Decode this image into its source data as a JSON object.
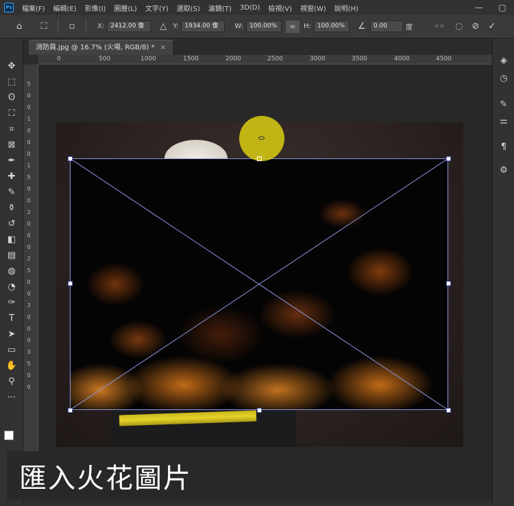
{
  "menubar": {
    "items": [
      "檔案(F)",
      "編輯(E)",
      "影像(I)",
      "圖層(L)",
      "文字(Y)",
      "選取(S)",
      "濾鏡(T)",
      "3D(D)",
      "檢視(V)",
      "視窗(W)",
      "說明(H)"
    ]
  },
  "options": {
    "x_label": "X:",
    "x_value": "2412.00 像",
    "y_label": "Y:",
    "y_value": "1934.00 像",
    "w_label": "W:",
    "w_value": "100.00%",
    "h_label": "H:",
    "h_value": "100.00%",
    "angle_value": "0.00",
    "angle_unit": "度"
  },
  "document": {
    "tab_title": "消防員.jpg @ 16.7% (火場, RGB/8) *"
  },
  "ruler": {
    "top_ticks": [
      "0",
      "500",
      "1000",
      "1500",
      "2000",
      "2500",
      "3000",
      "3500",
      "4000",
      "4500"
    ],
    "left_ticks": [
      "5",
      "0",
      "0",
      "1",
      "0",
      "0",
      "0",
      "1",
      "5",
      "0",
      "0",
      "2",
      "0",
      "0",
      "0",
      "2",
      "5",
      "0",
      "0",
      "3",
      "0",
      "0",
      "0",
      "3",
      "5",
      "0",
      "0"
    ]
  },
  "caption": {
    "text": "匯入火花圖片"
  },
  "colors": {
    "accent_handle": "#8a96e0",
    "reference_point": "#e1d412"
  },
  "icons": {
    "toolbar": [
      "move-icon",
      "marquee-icon",
      "lasso-icon",
      "quick-select-icon",
      "crop-icon",
      "frame-icon",
      "eyedropper-icon",
      "healing-icon",
      "brush-icon",
      "stamp-icon",
      "history-brush-icon",
      "eraser-icon",
      "gradient-icon",
      "blur-icon",
      "dodge-icon",
      "pen-icon",
      "type-icon",
      "path-select-icon",
      "rectangle-icon",
      "hand-icon",
      "zoom-icon",
      "more-icon"
    ]
  }
}
